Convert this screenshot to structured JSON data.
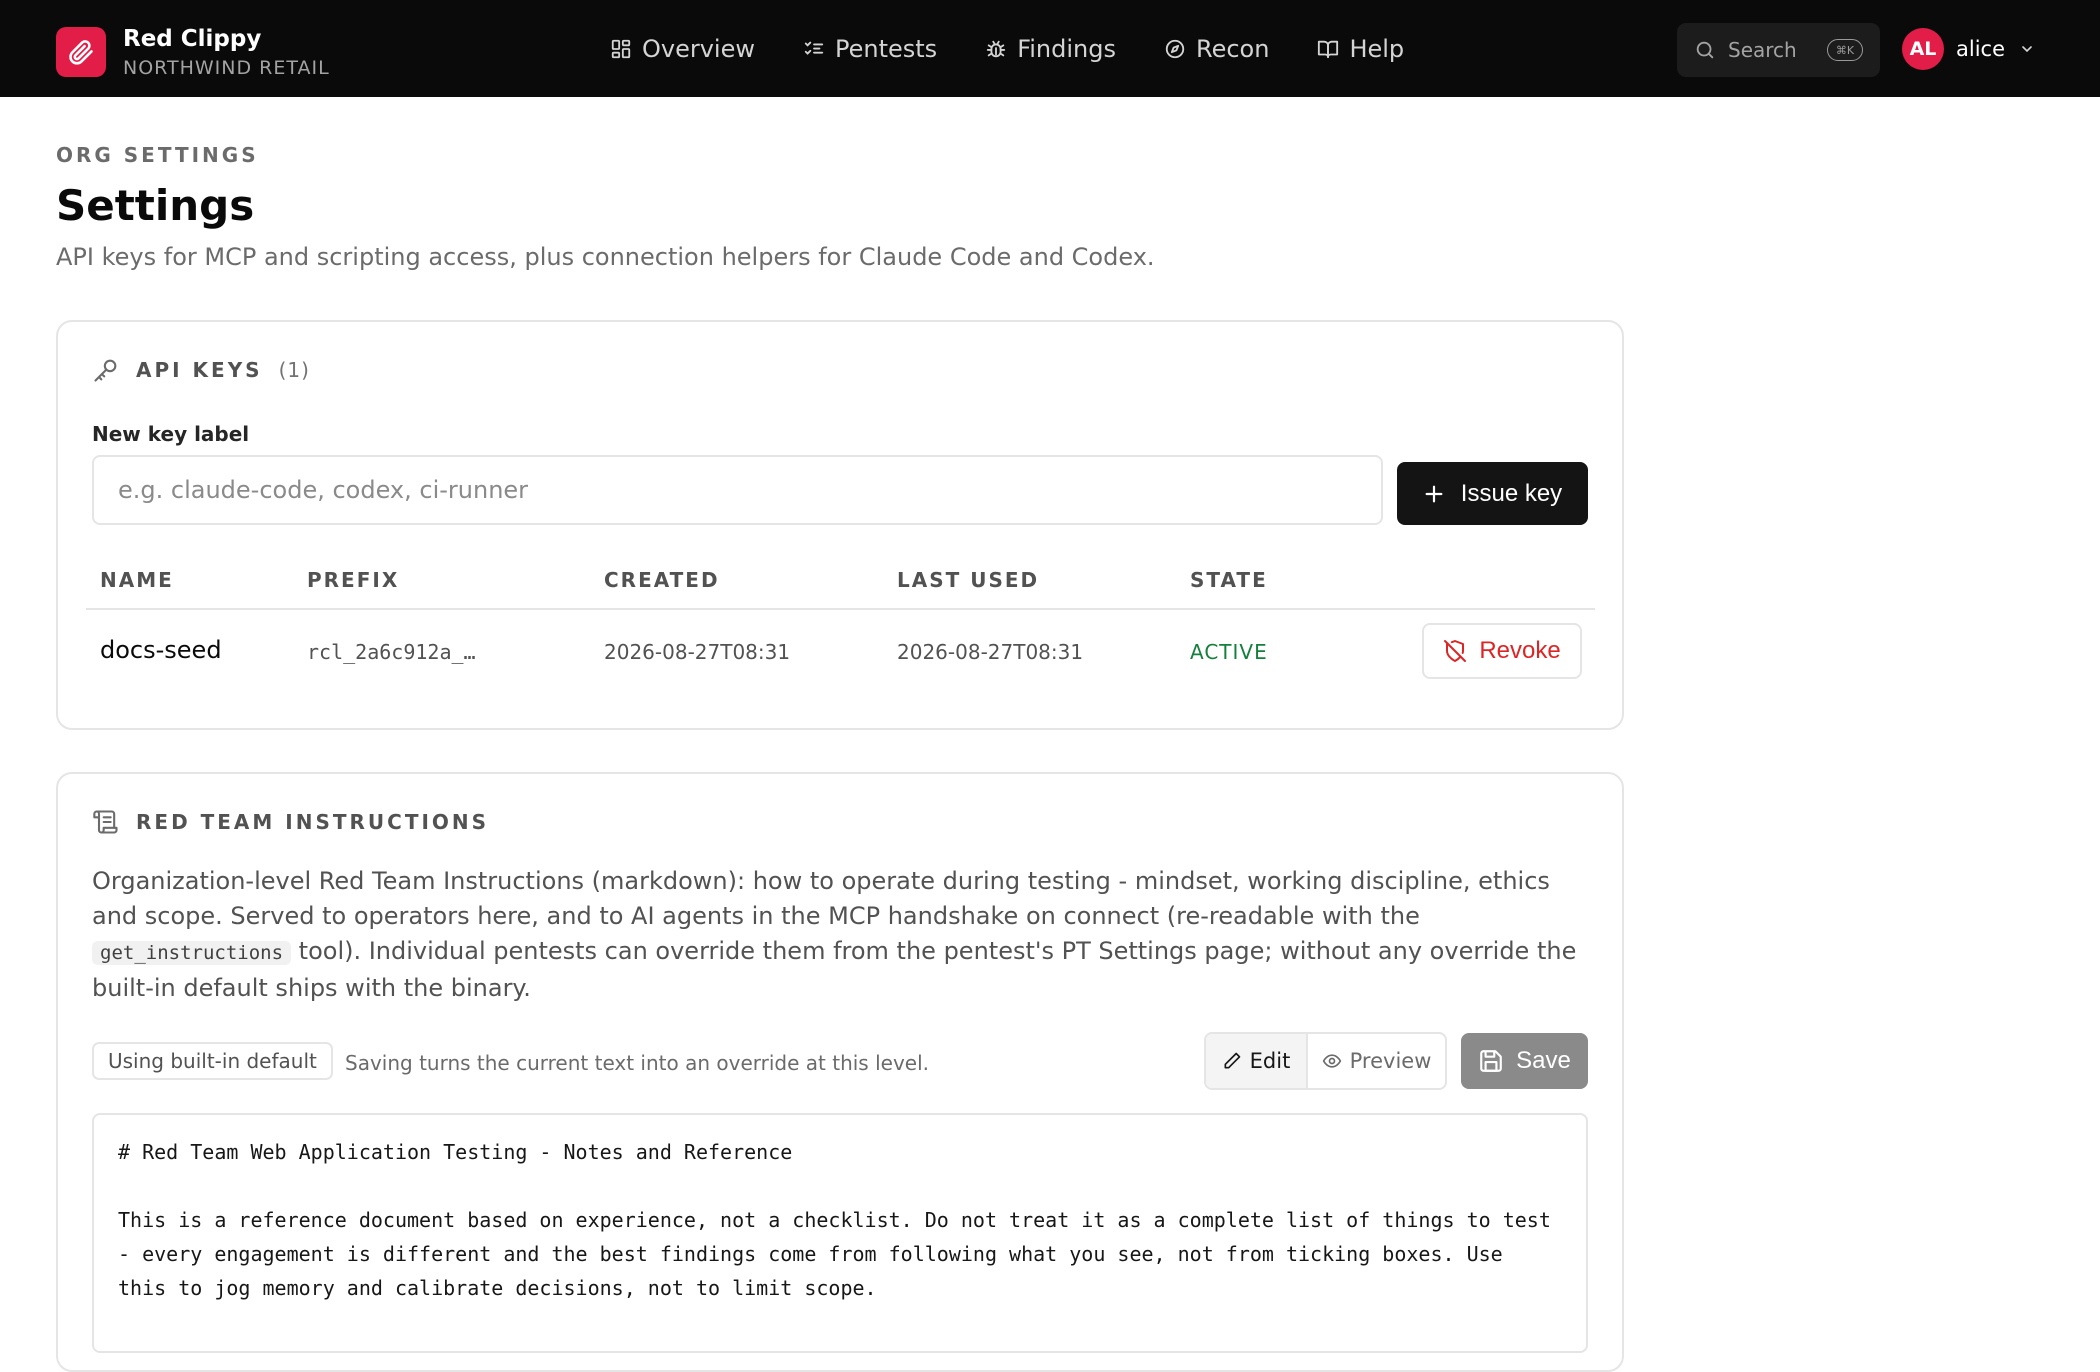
{
  "brand": {
    "name": "Red Clippy",
    "org": "NORTHWIND RETAIL"
  },
  "nav": [
    {
      "label": "Overview",
      "icon": "grid-icon"
    },
    {
      "label": "Pentests",
      "icon": "checklist-icon"
    },
    {
      "label": "Findings",
      "icon": "bug-icon"
    },
    {
      "label": "Recon",
      "icon": "compass-icon"
    },
    {
      "label": "Help",
      "icon": "book-icon"
    }
  ],
  "search": {
    "label": "Search",
    "shortcut": "⌘K"
  },
  "user": {
    "initials": "AL",
    "name": "alice"
  },
  "header": {
    "eyebrow": "ORG SETTINGS",
    "title": "Settings",
    "description": "API keys for MCP and scripting access, plus connection helpers for Claude Code and Codex."
  },
  "api_keys": {
    "title": "API KEYS",
    "count": "(1)",
    "field_label": "New key label",
    "placeholder": "e.g. claude-code, codex, ci-runner",
    "issue_label": "Issue key",
    "columns": [
      "NAME",
      "PREFIX",
      "CREATED",
      "LAST USED",
      "STATE"
    ],
    "rows": [
      {
        "name": "docs-seed",
        "prefix": "rcl_2a6c912a_…",
        "created": "2026-08-27T08:31",
        "last_used": "2026-08-27T08:31",
        "state": "ACTIVE",
        "action": "Revoke"
      }
    ]
  },
  "instructions": {
    "title": "RED TEAM INSTRUCTIONS",
    "desc_before": "Organization-level Red Team Instructions (markdown): how to operate during testing - mindset, working discipline, ethics and scope. Served to operators here, and to AI agents in the MCP handshake on connect (re-readable with the ",
    "desc_code": "get_instructions",
    "desc_after": " tool). Individual pentests can override them from the pentest's PT Settings page; without any override the built-in default ships with the binary.",
    "badge": "Using built-in default",
    "hint": "Saving turns the current text into an override at this level.",
    "edit_label": "Edit",
    "preview_label": "Preview",
    "save_label": "Save",
    "editor_text": "# Red Team Web Application Testing - Notes and Reference\n\nThis is a reference document based on experience, not a checklist. Do not treat it as a complete list of things to test - every engagement is different and the best findings come from following what you see, not from ticking boxes. Use this to jog memory and calibrate decisions, not to limit scope."
  },
  "colors": {
    "accent": "#e11d48",
    "topbar": "#0a0a0a",
    "active": "#15803d",
    "danger": "#dc2626"
  }
}
